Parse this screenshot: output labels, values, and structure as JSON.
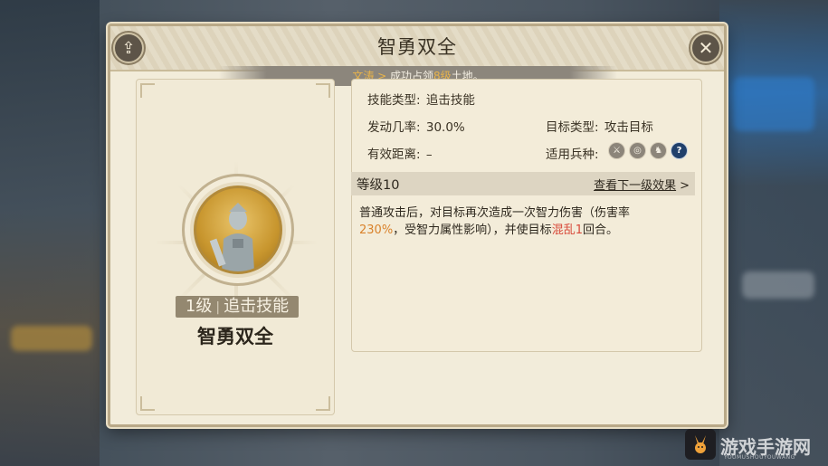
{
  "modal": {
    "title": "智勇双全",
    "share_icon": "share-icon",
    "close_icon": "close-icon",
    "close_glyph": "✕",
    "share_glyph": "⇪"
  },
  "banner": {
    "prefix": "文涛 > ",
    "text_before": "成功占领",
    "highlight": "8级",
    "text_after": "土地。"
  },
  "skill": {
    "level_tag": "1级",
    "type_tag": "追击技能",
    "name": "智勇双全"
  },
  "attributes": {
    "skill_type_label": "技能类型:",
    "skill_type_value": "追击技能",
    "trigger_rate_label": "发动几率:",
    "trigger_rate_value": "30.0%",
    "target_type_label": "目标类型:",
    "target_type_value": "攻击目标",
    "range_label": "有效距离:",
    "range_value": "–",
    "unit_types_label": "适用兵种:",
    "unit_icons": [
      "sword-icon",
      "bow-icon",
      "horse-icon",
      "help-icon"
    ]
  },
  "level": {
    "label": "等级10",
    "next_link": "查看下一级效果",
    "next_arrow": ">"
  },
  "description": {
    "part1": "普通攻击后，对目标再次造成一次智力伤害（伤害率",
    "rate": "230%",
    "part2": "，受智力属性影响），并使目标",
    "status": "混乱1",
    "part3": "回合。"
  },
  "watermark": {
    "text": "游戏手游网",
    "sub": "YOUMUSHOUYOUWANG"
  },
  "colors": {
    "highlight_orange": "#d9822b",
    "highlight_red": "#d84a3a",
    "banner_gold": "#e8b34a"
  }
}
